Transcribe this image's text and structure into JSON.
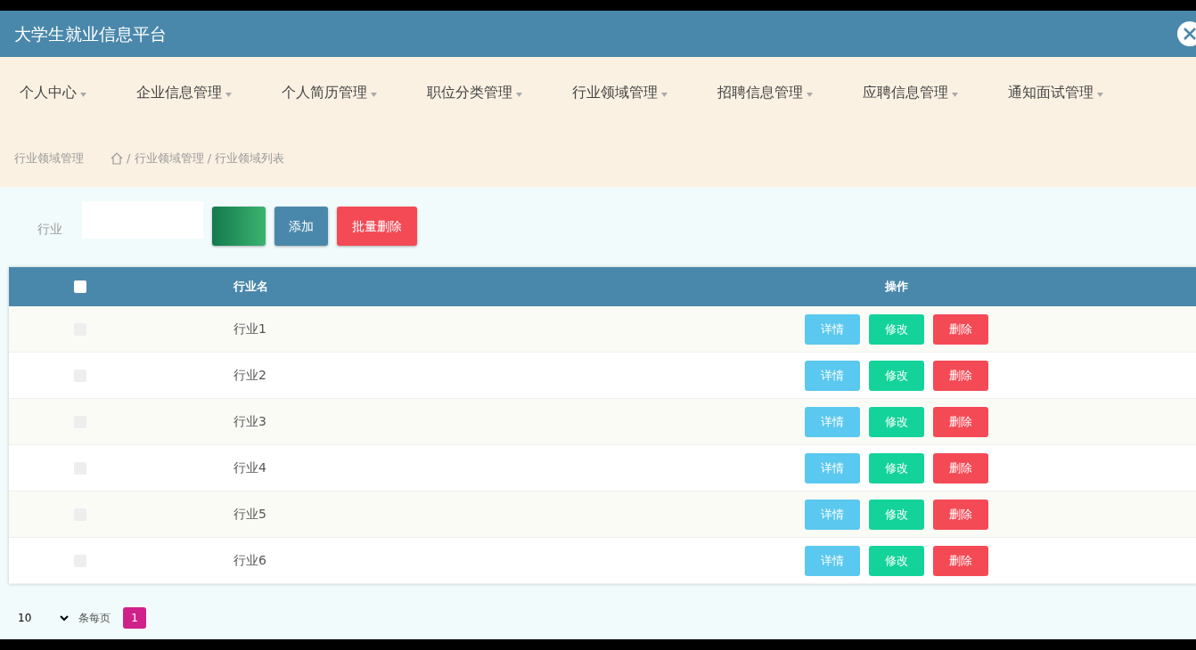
{
  "header": {
    "title": "大学生就业信息平台"
  },
  "menu": [
    {
      "label": "个人中心"
    },
    {
      "label": "企业信息管理"
    },
    {
      "label": "个人简历管理"
    },
    {
      "label": "职位分类管理"
    },
    {
      "label": "行业领域管理"
    },
    {
      "label": "招聘信息管理"
    },
    {
      "label": "应聘信息管理"
    },
    {
      "label": "通知面试管理"
    }
  ],
  "breadcrumb": {
    "page_title": "行业领域管理",
    "path": "/ 行业领域管理 / 行业领域列表"
  },
  "search": {
    "label": "行业"
  },
  "toolbar_buttons": [
    {
      "kind": "search"
    },
    {
      "label": "添加",
      "kind": "add"
    },
    {
      "label": "批量删除",
      "kind": "delete"
    }
  ],
  "table": {
    "header_checked": false,
    "columns": [
      "行业名",
      "操作"
    ],
    "rows": [
      {
        "checked": false,
        "name": "行业1",
        "actions": [
          "详情",
          "修改",
          "删除"
        ]
      },
      {
        "checked": false,
        "name": "行业2",
        "actions": [
          "详情",
          "修改",
          "删除"
        ]
      },
      {
        "checked": false,
        "name": "行业3",
        "actions": [
          "详情",
          "修改",
          "删除"
        ]
      },
      {
        "checked": false,
        "name": "行业4",
        "actions": [
          "详情",
          "修改",
          "删除"
        ]
      },
      {
        "checked": false,
        "name": "行业5",
        "actions": [
          "详情",
          "修改",
          "删除"
        ]
      },
      {
        "checked": false,
        "name": "行业6",
        "actions": [
          "详情",
          "修改",
          "删除"
        ]
      }
    ]
  },
  "pagination": {
    "page_size": "10",
    "page_size_label": "条每页",
    "pages": [
      {
        "label": "1",
        "selected": true
      }
    ]
  }
}
